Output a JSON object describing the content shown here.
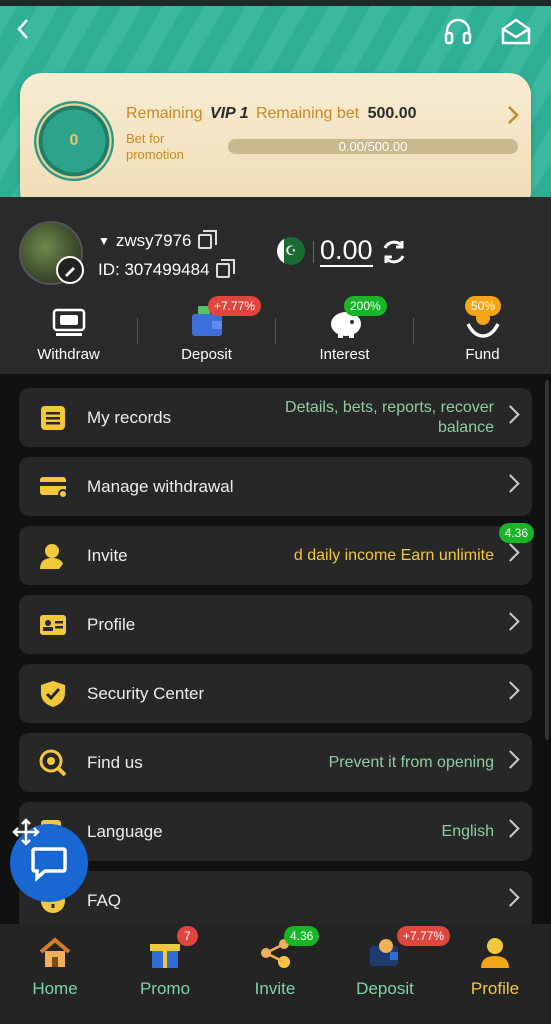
{
  "header": {
    "back_icon": "chevron-left-icon",
    "support_icon": "headset-icon",
    "mail_icon": "mail-icon"
  },
  "vip": {
    "prefix": "Remaining",
    "level": "VIP 1",
    "middle": "Remaining bet",
    "amount": "500.00",
    "sub": "Bet for promotion",
    "progress_text": "0.00/500.00",
    "progress": 0,
    "medal_level": "0"
  },
  "user": {
    "username": "zwsy7976",
    "id_text": "ID: 307499484",
    "balance": "0.00"
  },
  "actions": [
    {
      "label": "Withdraw",
      "icon": "withdraw-icon",
      "badge": ""
    },
    {
      "label": "Deposit",
      "icon": "wallet-icon",
      "badge": "+7.77%"
    },
    {
      "label": "Interest",
      "icon": "piggy-bank-icon",
      "badge": "200%"
    },
    {
      "label": "Fund",
      "icon": "hands-coin-icon",
      "badge": "50%"
    }
  ],
  "menu": [
    {
      "label": "My records",
      "value": "Details, bets, reports, recover balance",
      "icon": "records-icon"
    },
    {
      "label": "Manage withdrawal",
      "value": "",
      "icon": "card-settings-icon"
    },
    {
      "label": "Invite",
      "value": "d daily income  Earn unlimite",
      "icon": "invite-user-icon",
      "badge": "4.36"
    },
    {
      "label": "Profile",
      "value": "",
      "icon": "id-card-icon"
    },
    {
      "label": "Security Center",
      "value": "",
      "icon": "shield-check-icon"
    },
    {
      "label": "Find us",
      "value": "Prevent it from opening",
      "icon": "search-web-icon"
    },
    {
      "label": "Language",
      "value": "English",
      "icon": "language-icon"
    },
    {
      "label": "FAQ",
      "value": "",
      "icon": "faq-icon"
    }
  ],
  "nav": [
    {
      "label": "Home",
      "icon": "house-icon",
      "badge": ""
    },
    {
      "label": "Promo",
      "icon": "gift-icon",
      "badge": "7"
    },
    {
      "label": "Invite",
      "icon": "share-icon",
      "badge": "4.36"
    },
    {
      "label": "Deposit",
      "icon": "wallet-icon",
      "badge": "+7.77%"
    },
    {
      "label": "Profile",
      "icon": "profile-icon",
      "badge": ""
    }
  ],
  "colors": {
    "accent": "#2fb59a",
    "nav_text": "#7ed6a5",
    "active": "#f3c93c",
    "menu_value": "#8fcfa3"
  }
}
